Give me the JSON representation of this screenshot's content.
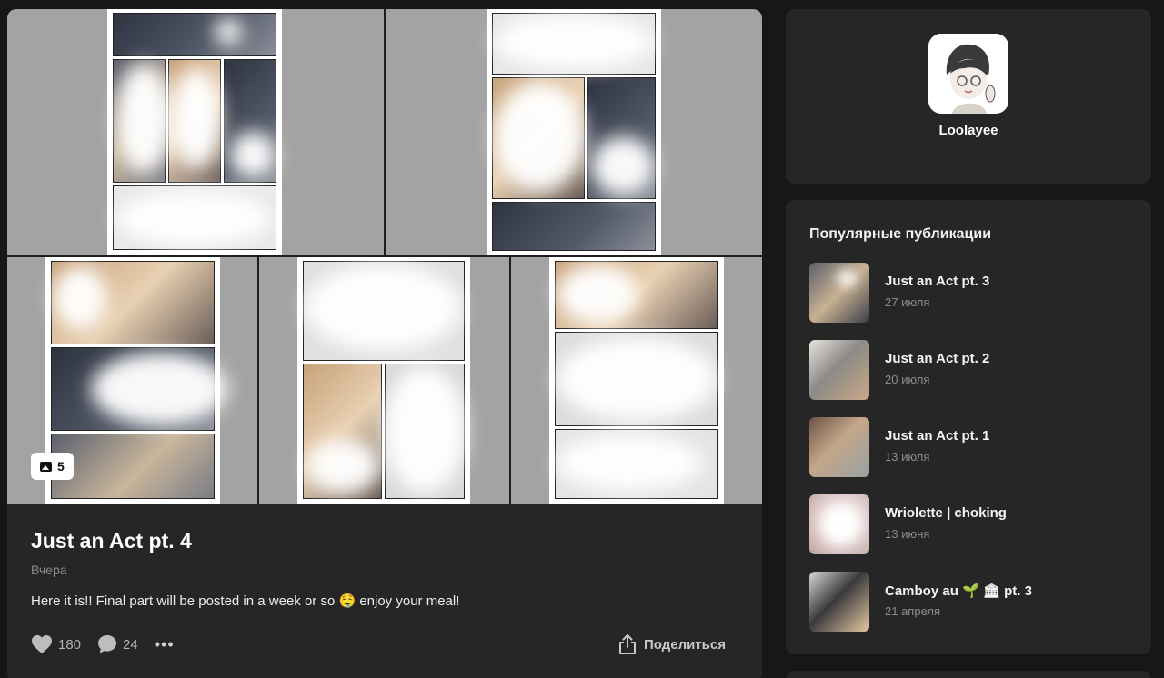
{
  "post": {
    "image_count": "5",
    "title": "Just an Act pt. 4",
    "date": "Вчера",
    "text": "Here it is!! Final part will be posted in a week or so 🤤 enjoy your meal!",
    "likes": "180",
    "comments": "24",
    "more_label": "•••",
    "share_label": "Поделиться"
  },
  "profile": {
    "name": "Loolayee"
  },
  "popular": {
    "heading": "Популярные публикации",
    "items": [
      {
        "title": "Just an Act pt. 3",
        "date": "27 июля"
      },
      {
        "title": "Just an Act pt. 2",
        "date": "20 июля"
      },
      {
        "title": "Just an Act pt. 1",
        "date": "13 июля"
      },
      {
        "title": "Wriolette | choking",
        "date": "13 июня"
      },
      {
        "title": "Camboy au 🌱 🏛 pt. 3",
        "date": "21 апреля"
      }
    ]
  },
  "colors": {
    "background": "#171717",
    "card": "#262626",
    "muted_text": "#8a8a8a",
    "gallery_cell": "#a3a3a3"
  },
  "icons": [
    "image-icon",
    "heart-icon",
    "comment-icon",
    "more-icon",
    "share-icon"
  ]
}
